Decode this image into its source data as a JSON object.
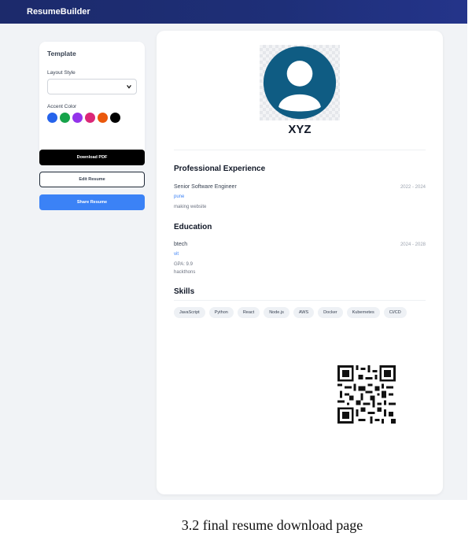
{
  "app": {
    "brand": "ResumeBuilder"
  },
  "sidebar": {
    "template_title": "Template",
    "layout_style_label": "Layout Style",
    "layout_style_value": "",
    "accent_color_label": "Accent Color",
    "accent_colors": [
      "#2563eb",
      "#16a34a",
      "#9333ea",
      "#db2777",
      "#ea580c",
      "#000000"
    ],
    "buttons": {
      "download": "Download PDF",
      "edit": "Edit Resume",
      "share": "Share Resume"
    }
  },
  "resume": {
    "name": "XYZ",
    "experience": {
      "title": "Professional Experience",
      "items": [
        {
          "role": "Senior Software Engineer",
          "dates": "2022 - 2024",
          "company": "pune",
          "description": "making website"
        }
      ]
    },
    "education": {
      "title": "Education",
      "items": [
        {
          "degree": "btech",
          "dates": "2024 - 2028",
          "institution": "vit",
          "gpa": "GPA: 9.9",
          "extra": "hackthons"
        }
      ]
    },
    "skills": {
      "title": "Skills",
      "items": [
        "JavaScript",
        "Python",
        "React",
        "Node.js",
        "AWS",
        "Docker",
        "Kubernetes",
        "CI/CD"
      ]
    }
  },
  "caption": "3.2  final resume download page"
}
